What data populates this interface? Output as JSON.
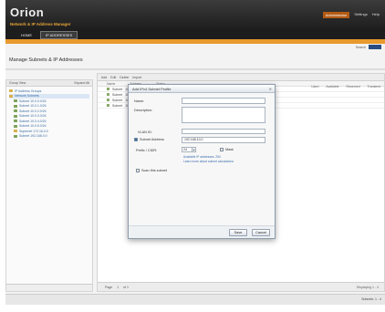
{
  "header": {
    "logo": "Orion",
    "subtitle": "Network & IP Address Manager",
    "top_links": [
      "Administrator",
      "Settings",
      "Help"
    ],
    "tabs": [
      "HOME",
      "IP ADDRESSES"
    ]
  },
  "utility": {
    "label": "Search"
  },
  "page": {
    "title": "Manage Subnets & IP Addresses"
  },
  "left_pane": {
    "header_left": "Group View",
    "header_right": "Expand All",
    "tree": [
      {
        "label": "IP Address Groups",
        "icon": "folder-icon",
        "selected": false
      },
      {
        "label": "Network Subnets",
        "icon": "folder-icon",
        "selected": true
      },
      {
        "label": "Subnet 10.0.0.0/24",
        "icon": "subnet-icon",
        "selected": false
      },
      {
        "label": "Subnet 10.0.1.0/24",
        "icon": "subnet-icon",
        "selected": false
      },
      {
        "label": "Subnet 10.0.2.0/24",
        "icon": "subnet-icon",
        "selected": false
      },
      {
        "label": "Subnet 10.0.3.0/24",
        "icon": "subnet-icon",
        "selected": false
      },
      {
        "label": "Subnet 10.0.4.0/24",
        "icon": "subnet-icon",
        "selected": false
      },
      {
        "label": "Subnet 10.0.5.0/24",
        "icon": "subnet-icon",
        "selected": false
      },
      {
        "label": "Supernet 172.16.0.0",
        "icon": "folder-icon",
        "selected": false
      },
      {
        "label": "Subnet 192.168.0.0",
        "icon": "subnet-icon",
        "selected": false
      }
    ]
  },
  "main": {
    "toolbar": [
      "Add",
      "Edit",
      "Delete",
      "Import"
    ],
    "columns": [
      "Name",
      "Address",
      "Status"
    ],
    "right_columns": [
      "Used",
      "Available",
      "Reserved",
      "Transient"
    ],
    "rows": [
      {
        "cells": [
          "Subnet",
          "10.0.0.0"
        ]
      },
      {
        "cells": [
          "Subnet",
          "10.0.1.0"
        ]
      },
      {
        "cells": [
          "Subnet",
          "10.0.2.0"
        ]
      },
      {
        "cells": [
          "Subnet",
          "10.0.3.0"
        ]
      }
    ],
    "pager": [
      "Page",
      "1",
      "of 1"
    ],
    "pager_info": "Displaying 1 - 4"
  },
  "dialog": {
    "title": "Add IPv4 Subnet Profile",
    "close": "✕",
    "name_label": "Name:",
    "description_label": "Description:",
    "vlan_label": "VLAN ID:",
    "address_label": "Subnet Address",
    "address_value": "192.168.10.0",
    "cidr_label": "Prefix / CIDR:",
    "cidr_value": "24",
    "mask_label": "Mask",
    "hint_line1": "Available IP addresses: 254",
    "hint_line2": "Learn more about subnet calculations",
    "option_label": "Scan this subnet",
    "save_label": "Save",
    "cancel_label": "Cancel"
  },
  "status": {
    "text": "Subnets: 1 - 4"
  },
  "colors": {
    "accent": "#e89a2d",
    "header_bg": "#1d1d1d",
    "link": "#3a6ea5"
  }
}
